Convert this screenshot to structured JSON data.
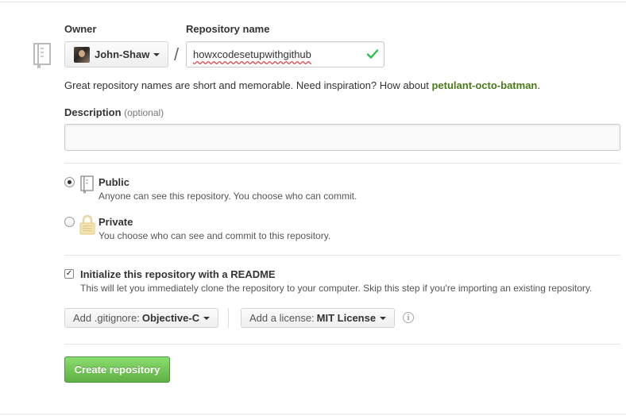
{
  "owner": {
    "label": "Owner",
    "name": "John-Shaw"
  },
  "repository": {
    "label": "Repository name",
    "value": "howxcodesetupwithgithub",
    "separator": "/"
  },
  "hint": {
    "prefix": "Great repository names are short and memorable. Need inspiration? How about",
    "suggestion": "petulant-octo-batman",
    "suffix": "."
  },
  "description": {
    "label": "Description",
    "optional": "(optional)",
    "value": ""
  },
  "visibility": {
    "selected": "Public",
    "public": {
      "title": "Public",
      "note": "Anyone can see this repository. You choose who can commit."
    },
    "private": {
      "title": "Private",
      "note": "You choose who can see and commit to this repository."
    }
  },
  "readme": {
    "checked": true,
    "check_mark": "✓",
    "title": "Initialize this repository with a README",
    "note": "This will let you immediately clone the repository to your computer. Skip this step if you're importing an existing repository."
  },
  "gitignore": {
    "prefix": "Add .gitignore:",
    "value": "Objective-C"
  },
  "license": {
    "prefix": "Add a license:",
    "value": "MIT License"
  },
  "info_symbol": "i",
  "create_button": "Create repository",
  "colors": {
    "accent_green": "#60b044",
    "suggestion_green": "#4a7a1a",
    "valid_check": "#2cbe4e"
  },
  "icons": [
    "repo-icon",
    "check-icon",
    "lock-icon",
    "info-icon",
    "caret-down-icon"
  ]
}
